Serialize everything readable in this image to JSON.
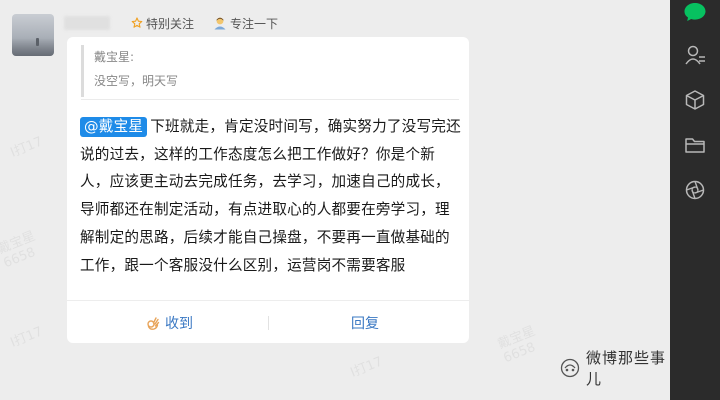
{
  "message": {
    "sender_name": "",
    "tags": {
      "special_follow": "特别关注",
      "focus": "专注一下"
    },
    "quote": {
      "author": "戴宝星:",
      "text": "没空写，明天写"
    },
    "mention": "@戴宝星",
    "body": "下班就走，肯定没时间写，确实努力了没写完还说的过去，这样的工作态度怎么把工作做好？你是个新人，应该更主动去完成任务，去学习，加速自己的成长，导师都还在制定活动，有点进取心的人都要在旁学习，理解制定的思路，后续才能自己操盘，不要再一直做基础的工作，跟一个客服没什么区别，运营岗不需要客服",
    "actions": {
      "received": "收到",
      "reply": "回复"
    }
  },
  "watermark": {
    "lines": [
      "I打17",
      "6658",
      "戴宝星",
      "6658"
    ]
  },
  "brand": "微博那些事儿",
  "right_bar": {
    "icons": [
      "chat-bubble-icon",
      "contacts-icon",
      "cube-icon",
      "folder-icon",
      "aperture-icon"
    ]
  },
  "colors": {
    "accent": "#07c160",
    "mention_bg": "#1e8be8",
    "link": "#3a78c3",
    "sidebar_bg": "#2b2b2b"
  }
}
